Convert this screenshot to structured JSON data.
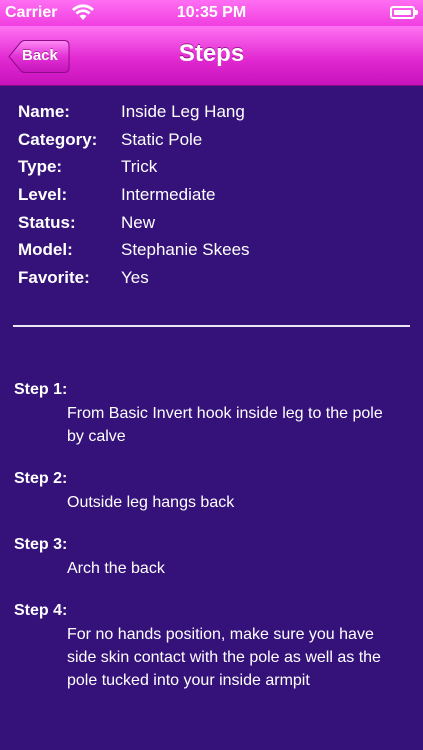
{
  "status_bar": {
    "carrier": "Carrier",
    "time": "10:35 PM"
  },
  "nav": {
    "back_label": "Back",
    "title": "Steps"
  },
  "details": [
    {
      "label": "Name:",
      "value": "Inside Leg Hang"
    },
    {
      "label": "Category:",
      "value": "Static Pole"
    },
    {
      "label": "Type:",
      "value": "Trick"
    },
    {
      "label": "Level:",
      "value": "Intermediate"
    },
    {
      "label": "Status:",
      "value": "New"
    },
    {
      "label": "Model:",
      "value": "Stephanie Skees"
    },
    {
      "label": "Favorite:",
      "value": "Yes"
    }
  ],
  "steps": [
    {
      "title": "Step 1:",
      "text": "From Basic Invert hook inside leg to the pole by calve"
    },
    {
      "title": "Step 2:",
      "text": "Outside leg hangs back"
    },
    {
      "title": "Step 3:",
      "text": "Arch the back"
    },
    {
      "title": "Step 4:",
      "text": "For no hands position, make sure you have side skin contact with the pole as well as the pole tucked into your inside armpit"
    }
  ],
  "colors": {
    "background": "#34127a",
    "nav_accent": "#e22ad2"
  },
  "icons": {
    "wifi": "wifi-icon",
    "battery": "battery-icon",
    "back": "chevron-left-icon"
  }
}
